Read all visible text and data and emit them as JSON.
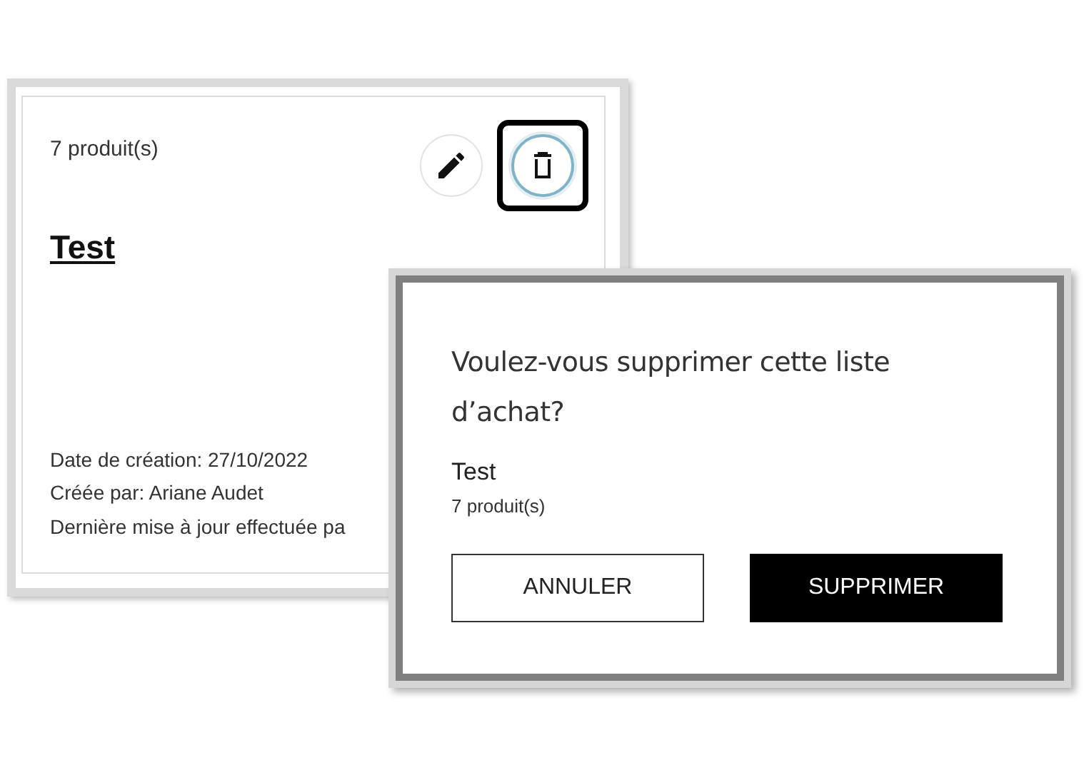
{
  "card": {
    "count": "7 produit(s)",
    "title": "Test",
    "actions": [
      {
        "kind": "edit",
        "focused": false
      },
      {
        "kind": "delete",
        "focused": true
      }
    ],
    "meta": [
      "Date de création: 27/10/2022",
      "Créée par: Ariane Audet",
      "Dernière mise à jour effectuée pa"
    ]
  },
  "dialog": {
    "question": "Voulez-vous supprimer cette liste d’achat?",
    "item_title": "Test",
    "item_count": "7 produit(s)",
    "buttons": [
      {
        "label": "ANNULER",
        "kind": "secondary"
      },
      {
        "label": "SUPPRIMER",
        "kind": "primary"
      }
    ]
  }
}
